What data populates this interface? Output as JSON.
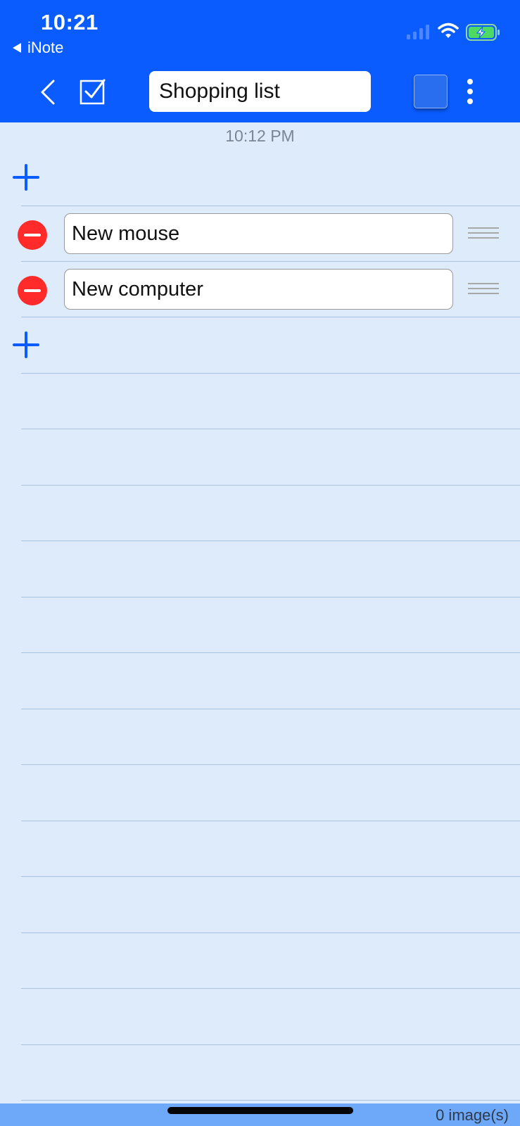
{
  "status_bar": {
    "time": "10:21",
    "back_app": "iNote"
  },
  "toolbar": {
    "title_value": "Shopping list",
    "color_swatch": "#2a6ef0"
  },
  "note": {
    "timestamp": "10:12 PM",
    "items": [
      {
        "text": "New mouse"
      },
      {
        "text": "New computer"
      }
    ]
  },
  "footer": {
    "image_count": "0 image(s)"
  },
  "colors": {
    "header": "#0a5cff",
    "background": "#deebfb",
    "accent": "#0a5cff",
    "delete": "#ff2a2a",
    "footer": "#6ea8f8"
  },
  "icons": {
    "back": "chevron-left-icon",
    "checkbox": "checkbox-checked-icon",
    "more": "more-vertical-icon",
    "add": "plus-icon",
    "delete": "minus-circle-icon",
    "reorder": "drag-handle-icon"
  }
}
